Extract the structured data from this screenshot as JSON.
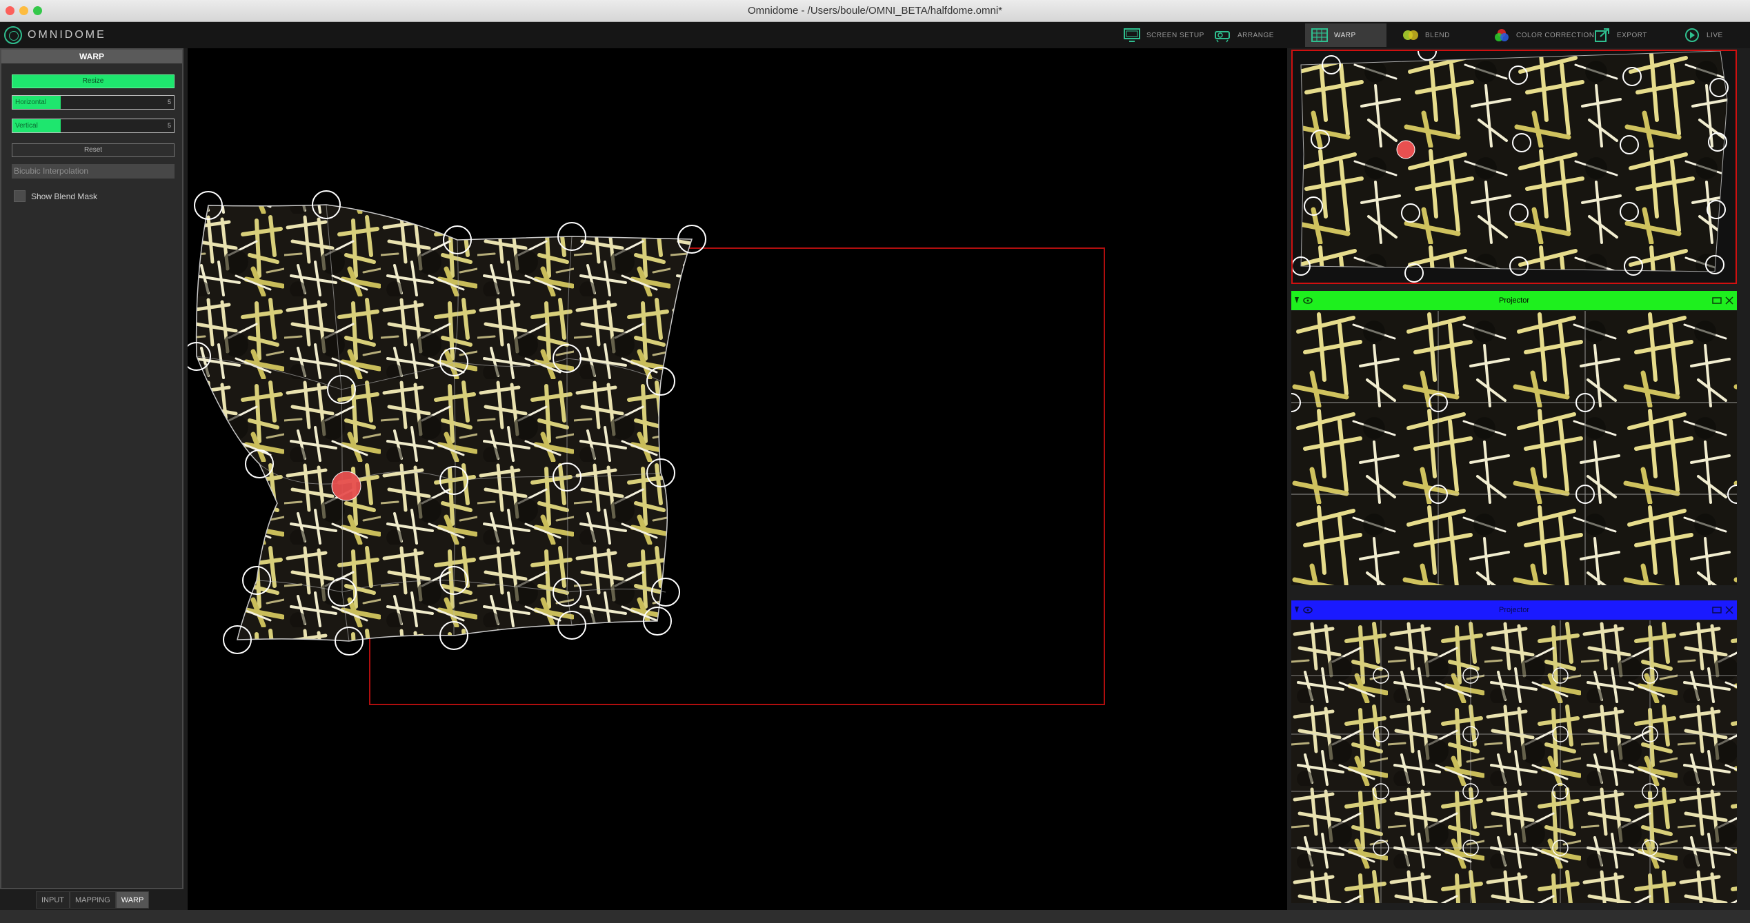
{
  "window": {
    "title": "Omnidome - /Users/boule/OMNI_BETA/halfdome.omni*",
    "traffic_colors": [
      "#fc605b",
      "#fdbc40",
      "#34c84a"
    ]
  },
  "app": {
    "logo_text": "OMNIDOME"
  },
  "toolbar": {
    "items": [
      {
        "label": "SCREEN SETUP",
        "icon": "monitor-icon"
      },
      {
        "label": "ARRANGE",
        "icon": "projector-icon"
      },
      {
        "label": "WARP",
        "icon": "grid-icon",
        "active": true
      },
      {
        "label": "BLEND",
        "icon": "blend-circles-icon"
      },
      {
        "label": "COLOR CORRECTION",
        "icon": "rgb-circles-icon"
      },
      {
        "label": "EXPORT",
        "icon": "export-icon"
      },
      {
        "label": "LIVE",
        "icon": "play-icon"
      }
    ]
  },
  "sidebar": {
    "title": "WARP",
    "resize_label": "Resize",
    "sliders": [
      {
        "label": "Horizontal",
        "value": "5",
        "level": 0.3
      },
      {
        "label": "Vertical",
        "value": "5",
        "level": 0.3
      }
    ],
    "reset_label": "Reset",
    "interpolation": "Bicubic Interpolation",
    "blend_mask_label": "Show Blend Mask",
    "blend_mask_checked": false
  },
  "bottom_tabs": [
    {
      "label": "INPUT",
      "active": false
    },
    {
      "label": "MAPPING",
      "active": false
    },
    {
      "label": "WARP",
      "active": true
    }
  ],
  "right_panel": {
    "projectors": [
      {
        "label": "Projector",
        "color": "#1ef01e"
      },
      {
        "label": "Projector",
        "color": "#1a1aff"
      }
    ]
  },
  "colors": {
    "accent": "#1ee66e",
    "selected_point": "#e85050",
    "selection_frame": "#d01010"
  }
}
